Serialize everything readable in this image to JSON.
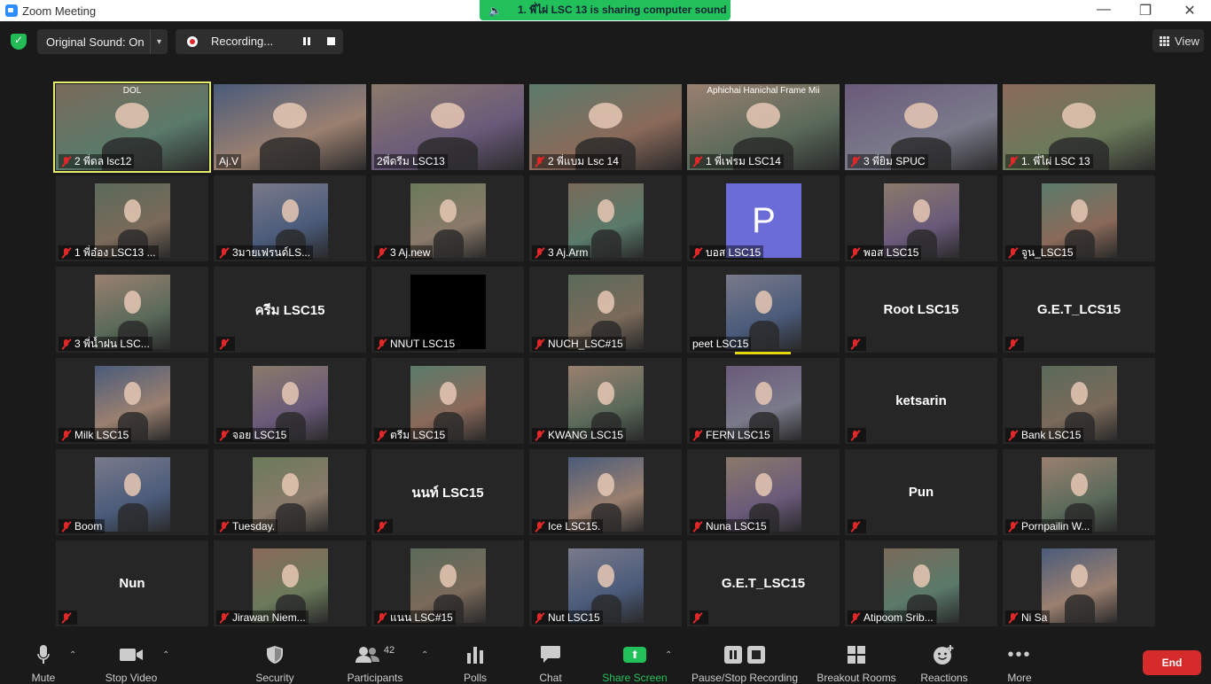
{
  "window": {
    "title": "Zoom Meeting"
  },
  "sharing_banner": {
    "text": "1. พี่ไผ่ LSC 13 is sharing computer sound"
  },
  "topbar": {
    "original_sound": "Original Sound: On",
    "recording": "Recording...",
    "view_label": "View"
  },
  "tiles": [
    {
      "label": "2 พี่ดล lsc12",
      "overlay": "DOL"
    },
    {
      "label": "Aj.V"
    },
    {
      "label": "2พี่ดรีม LSC13"
    },
    {
      "label": "2 พี่แบม Lsc 14"
    },
    {
      "label": "1 พี่เฟรม LSC14",
      "overlay": "Aphichai Hanichal Frame Mii"
    },
    {
      "label": "3 พี่ยิม SPUC"
    },
    {
      "label": "1. พี่ไผ่ LSC 13"
    },
    {
      "label": "1 พี่อ๋อง LSC13 ..."
    },
    {
      "label": "3มายเฟรนด์LS..."
    },
    {
      "label": "3 Aj.new"
    },
    {
      "label": "3 Aj.Arm"
    },
    {
      "label": "บอส LSC15",
      "avatar_letter": "P"
    },
    {
      "label": "พอส LSC15"
    },
    {
      "label": "จูน_LSC15"
    },
    {
      "label": "3 พี่น้ำฝน LSC..."
    },
    {
      "label": "",
      "name": "ครีม LSC15"
    },
    {
      "label": "NNUT LSC15"
    },
    {
      "label": "NUCH_LSC#15"
    },
    {
      "label": "peet LSC15"
    },
    {
      "label": "",
      "name": "Root LSC15"
    },
    {
      "label": "",
      "name": "G.E.T_LCS15"
    },
    {
      "label": "Milk LSC15"
    },
    {
      "label": "จอย LSC15"
    },
    {
      "label": "ตรีม LSC15"
    },
    {
      "label": "KWANG LSC15"
    },
    {
      "label": "FERN LSC15"
    },
    {
      "label": "",
      "name": "ketsarin"
    },
    {
      "label": "Bank LSC15"
    },
    {
      "label": "Boom"
    },
    {
      "label": "Tuesday."
    },
    {
      "label": "",
      "name": "นนท์ LSC15"
    },
    {
      "label": "Ice LSC15."
    },
    {
      "label": "Nuna LSC15"
    },
    {
      "label": "",
      "name": "Pun"
    },
    {
      "label": "Pornpailin W..."
    },
    {
      "label": "",
      "name": "Nun"
    },
    {
      "label": "Jirawan Niem..."
    },
    {
      "label": "แนน LSC#15"
    },
    {
      "label": "Nut LSC15"
    },
    {
      "label": "",
      "name": "G.E.T_LSC15"
    },
    {
      "label": "Atipoom Srib..."
    },
    {
      "label": "Ni Sa"
    }
  ],
  "toolbar": {
    "mute": "Mute",
    "video": "Stop Video",
    "security": "Security",
    "participants": "Participants",
    "participants_count": "42",
    "polls": "Polls",
    "chat": "Chat",
    "share": "Share Screen",
    "record": "Pause/Stop Recording",
    "breakout": "Breakout Rooms",
    "reactions": "Reactions",
    "more": "More",
    "end": "End"
  },
  "colors": {
    "accent_green": "#22c05a",
    "end_red": "#d52b2b",
    "active_outline": "#e6ee6e"
  }
}
